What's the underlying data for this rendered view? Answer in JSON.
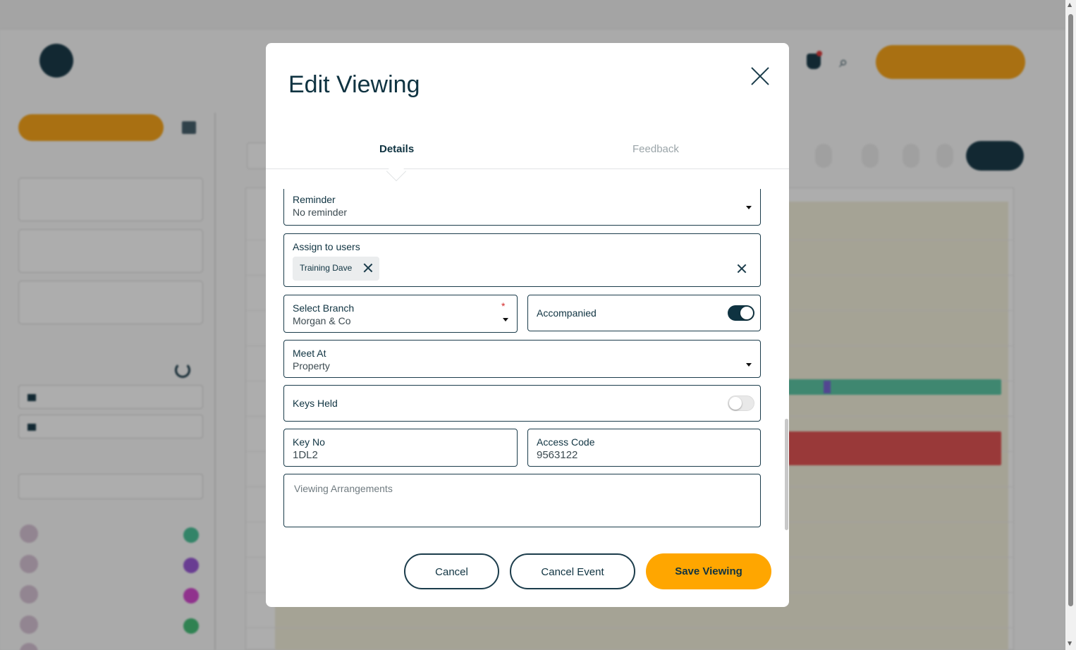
{
  "modal": {
    "title": "Edit Viewing",
    "tabs": [
      {
        "label": "Details",
        "active": true
      },
      {
        "label": "Feedback",
        "active": false
      }
    ],
    "fields": {
      "reminder": {
        "label": "Reminder",
        "value": "No reminder"
      },
      "assign_users": {
        "label": "Assign to users",
        "chips": [
          "Training Dave"
        ]
      },
      "branch": {
        "label": "Select Branch",
        "value": "Morgan & Co",
        "required_mark": "*"
      },
      "accompanied": {
        "label": "Accompanied",
        "checked": true
      },
      "meet_at": {
        "label": "Meet At",
        "value": "Property"
      },
      "keys_held": {
        "label": "Keys Held",
        "checked": false
      },
      "key_no": {
        "label": "Key No",
        "value": "1DL2"
      },
      "access_code": {
        "label": "Access Code",
        "value": "9563122"
      },
      "viewing_arrangements": {
        "placeholder": "Viewing Arrangements",
        "value": ""
      }
    },
    "buttons": {
      "cancel": "Cancel",
      "cancel_event": "Cancel Event",
      "save": "Save Viewing"
    }
  },
  "colors": {
    "primary": "#ffa600",
    "brand_dark": "#0f3341",
    "required": "#d42b2b",
    "overlay": "rgba(0,0,0,0.32)"
  },
  "icons": {
    "close": "close-icon",
    "chip_remove": "chip-remove-icon",
    "clear_all": "clear-all-icon",
    "dropdown": "chevron-down-icon"
  }
}
